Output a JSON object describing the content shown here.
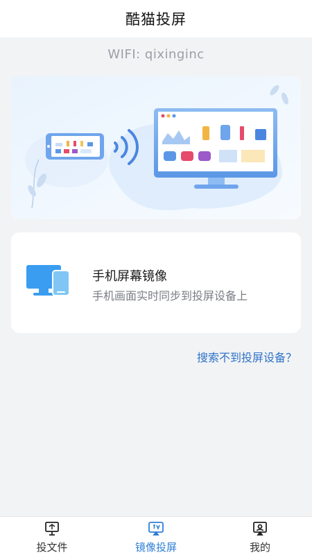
{
  "header": {
    "title": "酷猫投屏"
  },
  "wifi": {
    "label": "WIFI: qixinginc"
  },
  "banner": {
    "icon": "screen-mirroring-illustration"
  },
  "mirror_card": {
    "title": "手机屏幕镜像",
    "subtitle": "手机画面实时同步到投屏设备上",
    "icon": "monitor-phone-icon"
  },
  "help_link": "搜索不到投屏设备？",
  "tabbar": {
    "tabs": [
      {
        "label": "投文件",
        "icon": "cast-file-icon"
      },
      {
        "label": "镜像投屏",
        "icon": "tv-cast-icon",
        "active": true
      },
      {
        "label": "我的",
        "icon": "profile-icon"
      }
    ]
  },
  "colors": {
    "accent": "#2f7fd6",
    "link": "#2e73c8",
    "background": "#f2f3f5"
  }
}
